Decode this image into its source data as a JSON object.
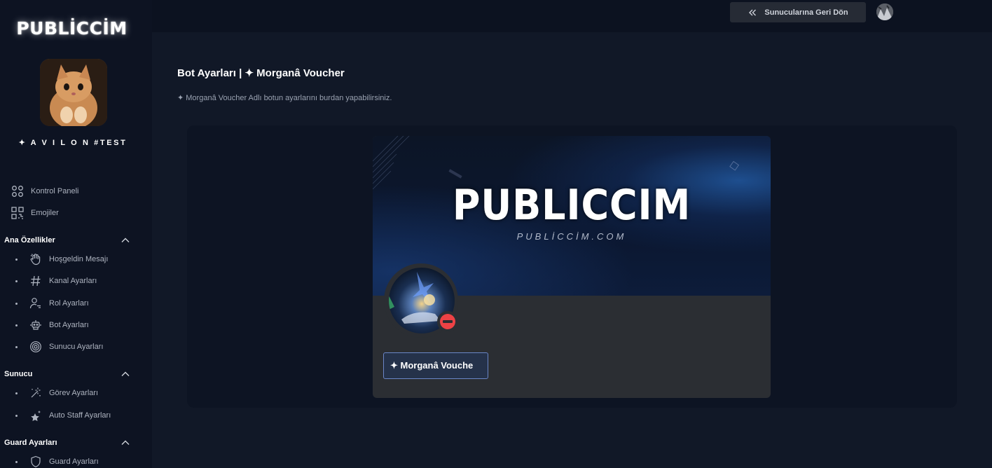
{
  "brand": "PUBLİCCİM",
  "server": {
    "name": "✦ A V I L O N #TEST"
  },
  "nav": [
    {
      "label": "Kontrol Paneli",
      "icon": "grid-icon"
    },
    {
      "label": "Emojiler",
      "icon": "qr-icon"
    }
  ],
  "sections": [
    {
      "title": "Ana Özellikler",
      "items": [
        {
          "label": "Hoşgeldin Mesajı",
          "icon": "wave-hand-icon"
        },
        {
          "label": "Kanal Ayarları",
          "icon": "hashtag-icon"
        },
        {
          "label": "Rol Ayarları",
          "icon": "user-role-icon"
        },
        {
          "label": "Bot Ayarları",
          "icon": "robot-icon"
        },
        {
          "label": "Sunucu Ayarları",
          "icon": "target-icon"
        }
      ]
    },
    {
      "title": "Sunucu",
      "items": [
        {
          "label": "Görev Ayarları",
          "icon": "magic-wand-icon"
        },
        {
          "label": "Auto Staff Ayarları",
          "icon": "stars-icon"
        }
      ]
    },
    {
      "title": "Guard Ayarları",
      "items": [
        {
          "label": "Guard Ayarları",
          "icon": "shield-icon"
        }
      ]
    }
  ],
  "topbar": {
    "back_label": "Sunucularına Geri Dön"
  },
  "page": {
    "title": "Bot Ayarları | ✦ Morganâ Voucher",
    "subtitle": "✦ Morganâ Voucher Adlı botun ayarlarını burdan yapabilirsiniz."
  },
  "card": {
    "banner_title": "PUBLICCIM",
    "banner_url": "PUBLİCCİM.COM",
    "bot_name": "✦ Morganâ Vouche",
    "status": "dnd"
  },
  "colors": {
    "status_dnd": "#ed4245",
    "accent_border": "#6a86c7"
  }
}
